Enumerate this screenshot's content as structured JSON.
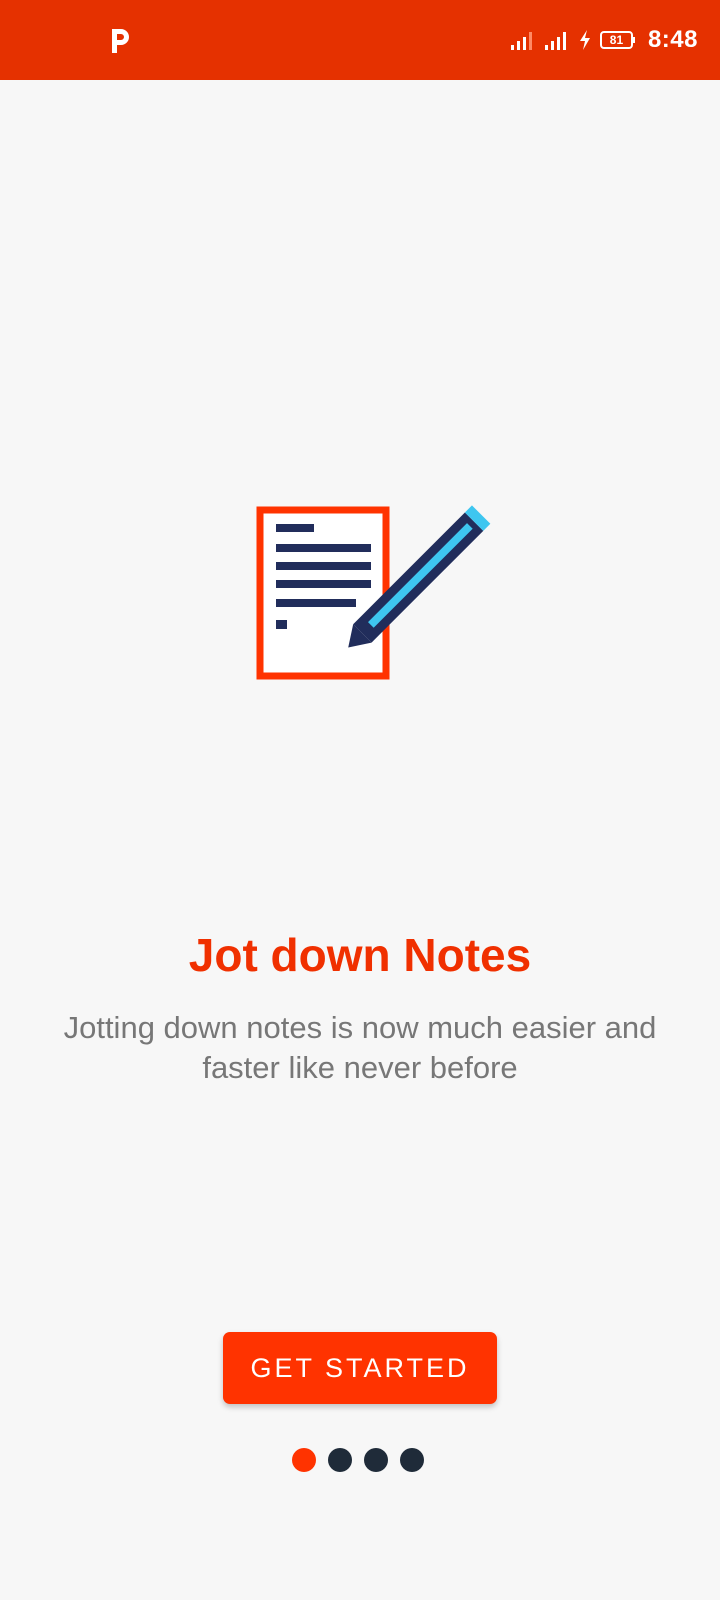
{
  "status_bar": {
    "app_icon": "p-icon",
    "time": "8:48",
    "battery_level": "81",
    "color": "#e53100"
  },
  "onboarding": {
    "illustration": "note-with-pencil-icon",
    "title": "Jot down Notes",
    "subtitle": "Jotting down notes is now much easier and faster like never before",
    "button_label": "GET STARTED",
    "page_indicator": {
      "current": 1,
      "total": 4
    },
    "accent_color": "#ff3300"
  }
}
